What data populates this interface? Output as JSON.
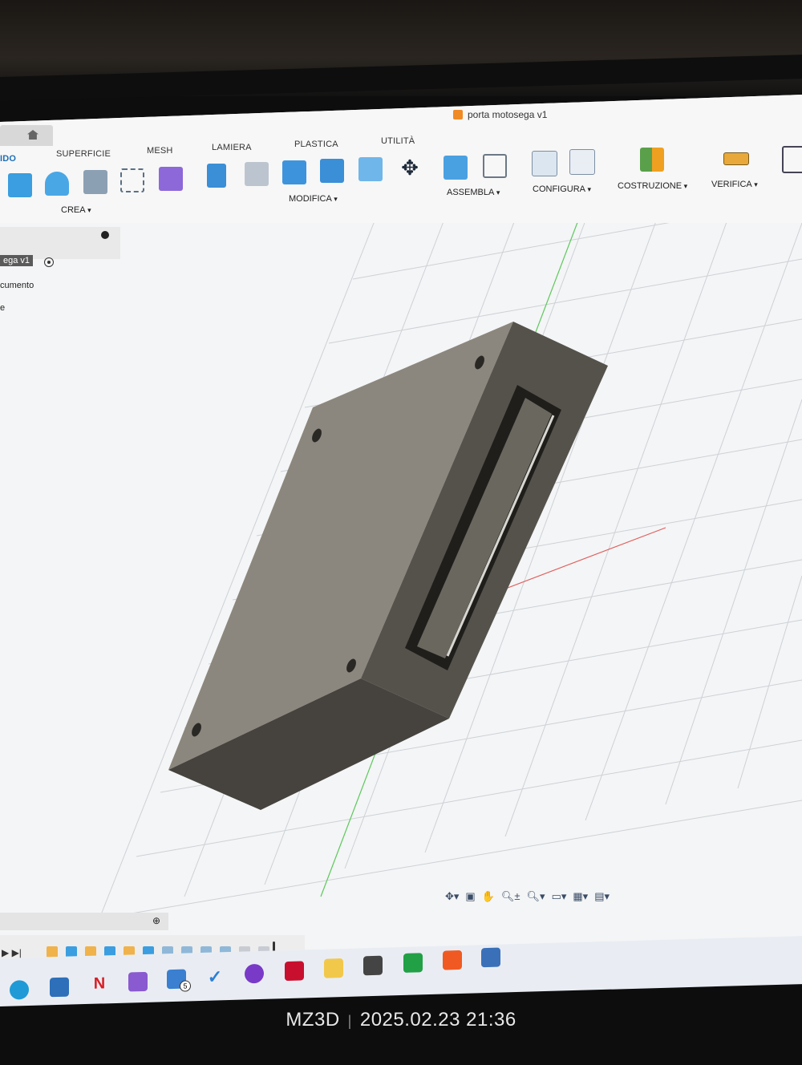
{
  "window": {
    "title": "porta motosega v1"
  },
  "ribbon": {
    "tabs": [
      {
        "label": "IDO",
        "active": true
      },
      {
        "label": "SUPERFICIE"
      },
      {
        "label": "MESH"
      },
      {
        "label": "LAMIERA"
      },
      {
        "label": "PLASTICA"
      },
      {
        "label": "UTILITÀ"
      }
    ],
    "groups": {
      "crea": "CREA",
      "modifica": "MODIFICA",
      "assembla": "ASSEMBLA",
      "configura": "CONFIGURA",
      "costruzione": "COSTRUZIONE",
      "verifica": "VERIFICA"
    }
  },
  "browser": {
    "root_label": "ega v1",
    "items": [
      "cumento",
      "e"
    ]
  },
  "navbar": {
    "icons": [
      "orbit-icon",
      "look-at-icon",
      "pan-icon",
      "zoom-icon",
      "fit-icon",
      "display-mode-icon",
      "grid-icon",
      "viewports-icon"
    ]
  },
  "timeline": {
    "items": [
      "sketch",
      "extrude",
      "sketch",
      "extrude",
      "sketch",
      "extrude",
      "fillet",
      "fillet",
      "fillet",
      "fillet",
      "fillet",
      "fillet"
    ]
  },
  "taskbar": {
    "badge_count": "5"
  },
  "colors": {
    "accent": "#1f6fb6",
    "body_top": "#8a857c",
    "body_side": "#5a5650",
    "body_front": "#4a4741",
    "grid": "#c9cdd2"
  },
  "watermark": {
    "brand": "MZ3D",
    "datetime": "2025.02.23 21:36"
  }
}
